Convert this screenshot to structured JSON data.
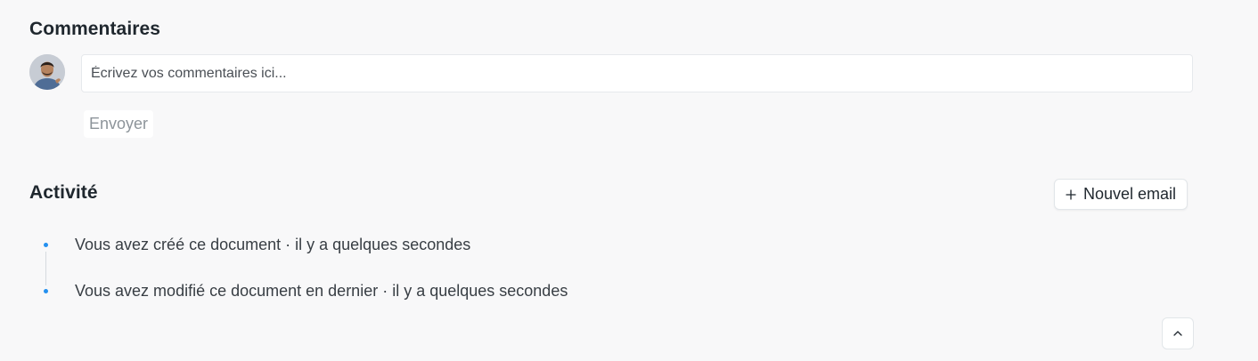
{
  "comments": {
    "title": "Commentaires",
    "input_placeholder": "Écrivez vos commentaires ici...",
    "input_value": "",
    "send_label": "Envoyer",
    "avatar_icon": "user-avatar-photo"
  },
  "activity": {
    "title": "Activité",
    "new_email_label": "Nouvel email",
    "new_email_icon": "plus-icon",
    "items": [
      {
        "text": "Vous avez créé ce document · il y a quelques secondes"
      },
      {
        "text": "Vous avez modifié ce document en dernier · il y a quelques secondes"
      }
    ]
  },
  "scroll_top": {
    "icon": "chevron-up-icon"
  },
  "colors": {
    "accent": "#2490ef",
    "background": "#f8f8f9",
    "text": "#1f272e",
    "muted": "#8d949a"
  }
}
